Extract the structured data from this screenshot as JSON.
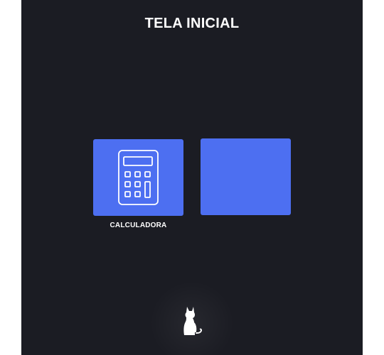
{
  "header": {
    "title": "TELA INICIAL"
  },
  "apps": [
    {
      "label": "CALCULADORA",
      "icon": "calculator-icon"
    },
    {
      "label": "",
      "icon": ""
    }
  ],
  "dock": {
    "icon": "cat-icon"
  },
  "colors": {
    "background": "#1b1c23",
    "tile": "#4d6ff1",
    "text": "#ffffff"
  }
}
